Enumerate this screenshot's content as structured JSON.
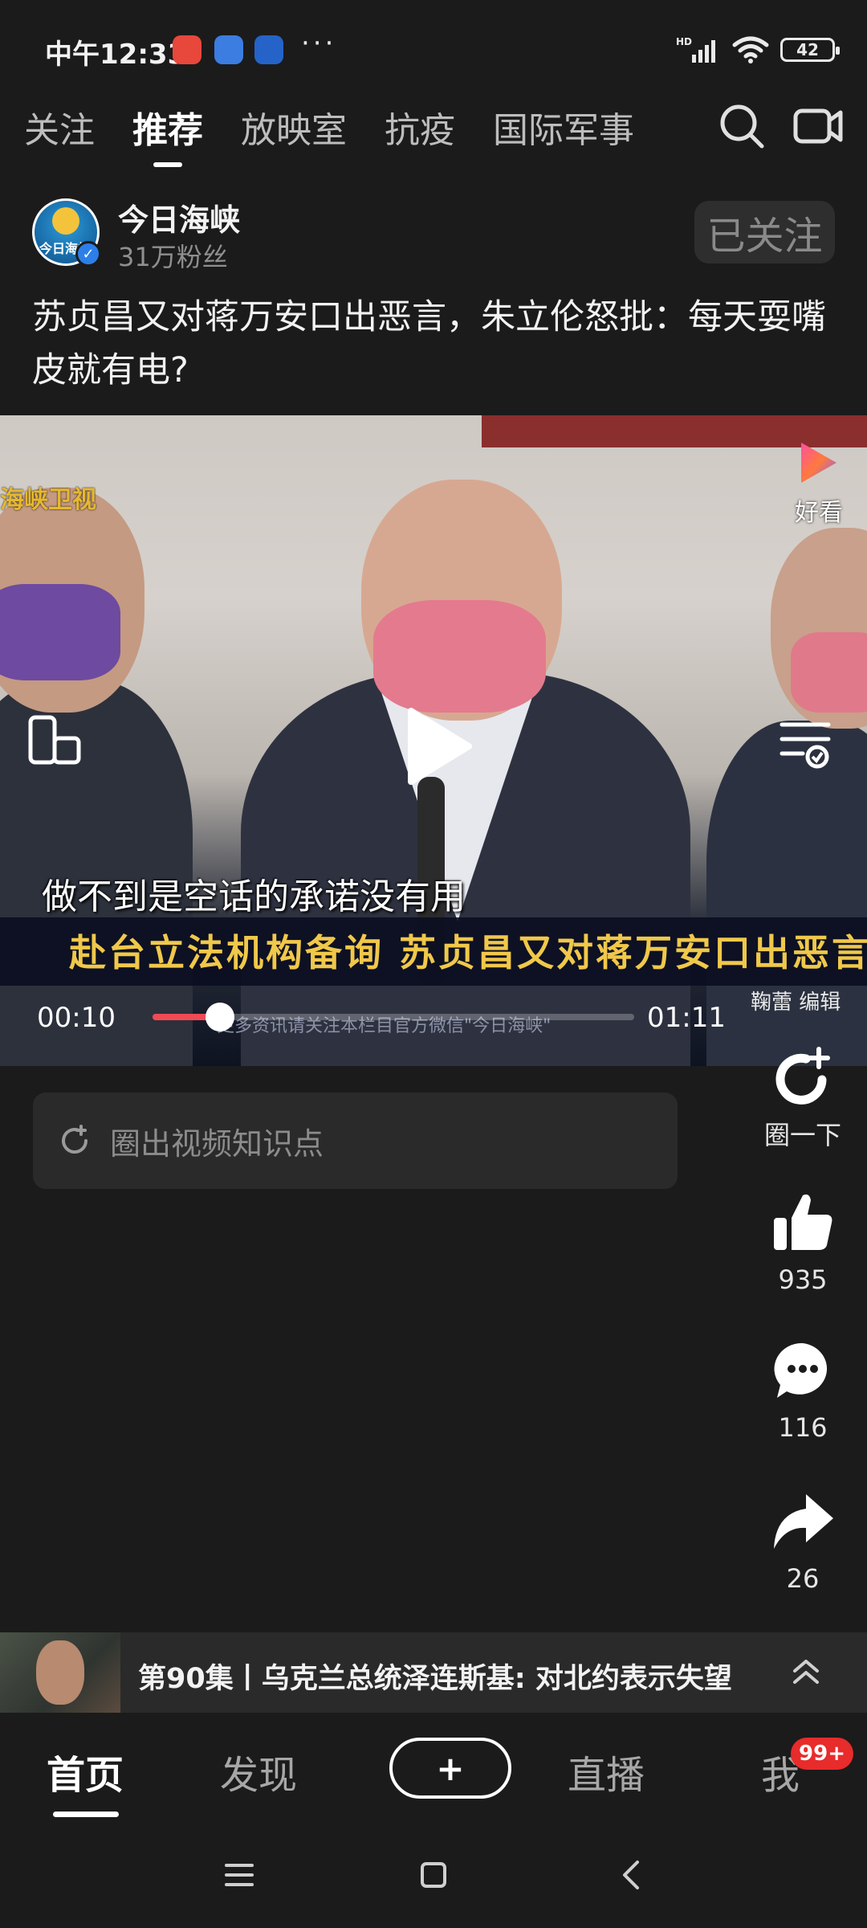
{
  "status_bar": {
    "time": "中午12:33",
    "more_dots": "···",
    "network": "HD",
    "battery": "42",
    "app_icon_colors": [
      "#e8473c",
      "#3b7de0",
      "#2563c9"
    ]
  },
  "top_tabs": [
    {
      "label": "关注",
      "active": false
    },
    {
      "label": "推荐",
      "active": true
    },
    {
      "label": "放映室",
      "active": false
    },
    {
      "label": "抗疫",
      "active": false
    },
    {
      "label": "国际军事",
      "active": false
    }
  ],
  "author": {
    "name": "今日海峡",
    "fans": "31万粉丝",
    "avatar_text": "今日海峡",
    "follow_label": "已关注"
  },
  "post": {
    "title": "苏贞昌又对蒋万安口出恶言，朱立伦怒批：每天耍嘴皮就有电?"
  },
  "video": {
    "channel_watermark": "海峡卫视",
    "haokan_label": "好看",
    "subtitle": "做不到是空话的承诺没有用",
    "caption": "赴台立法机构备询 苏贞昌又对蒋万安口出恶言",
    "editor_credit": "鞠蕾 编辑",
    "ticker": "更多资讯请关注本栏目官方微信\"今日海峡\"",
    "time_current": "00:10",
    "time_total": "01:11",
    "progress": 0.14,
    "accent_color": "#f04a55"
  },
  "knowledge": {
    "placeholder": "圈出视频知识点"
  },
  "rail": {
    "circle_label": "圈一下",
    "likes": "935",
    "comments": "116",
    "shares": "26"
  },
  "playlist": {
    "title": "第90集丨乌克兰总统泽连斯基: 对北约表示失望"
  },
  "bottom_nav": {
    "home": "首页",
    "discover": "发现",
    "publish": "+",
    "live": "直播",
    "me": "我",
    "badge": "99+"
  }
}
